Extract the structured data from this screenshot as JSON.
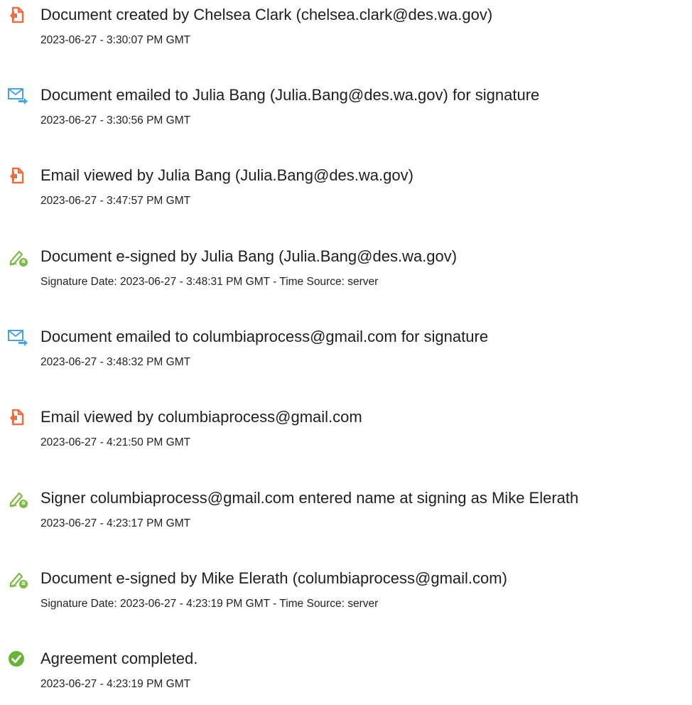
{
  "events": [
    {
      "icon": "document-created-icon",
      "title": "Document created by Chelsea Clark (chelsea.clark@des.wa.gov)",
      "stamp": "2023-06-27 - 3:30:07 PM GMT"
    },
    {
      "icon": "email-sent-icon",
      "title": "Document emailed to Julia Bang (Julia.Bang@des.wa.gov) for signature",
      "stamp": "2023-06-27 - 3:30:56 PM GMT"
    },
    {
      "icon": "document-created-icon",
      "title": "Email viewed by Julia Bang (Julia.Bang@des.wa.gov)",
      "stamp": "2023-06-27 - 3:47:57 PM GMT"
    },
    {
      "icon": "e-sign-pen-icon",
      "title": "Document e-signed by Julia Bang (Julia.Bang@des.wa.gov)",
      "stamp": "Signature Date: 2023-06-27 - 3:48:31 PM GMT - Time Source: server"
    },
    {
      "icon": "email-sent-icon",
      "title": "Document emailed to columbiaprocess@gmail.com for signature",
      "stamp": "2023-06-27 - 3:48:32 PM GMT"
    },
    {
      "icon": "document-created-icon",
      "title": "Email viewed by columbiaprocess@gmail.com",
      "stamp": "2023-06-27 - 4:21:50 PM GMT"
    },
    {
      "icon": "e-sign-pen-icon",
      "title": "Signer columbiaprocess@gmail.com entered name at signing as Mike Elerath",
      "stamp": "2023-06-27 - 4:23:17 PM GMT"
    },
    {
      "icon": "e-sign-pen-icon",
      "title": "Document e-signed by Mike Elerath (columbiaprocess@gmail.com)",
      "stamp": "Signature Date: 2023-06-27 - 4:23:19 PM GMT - Time Source: server"
    },
    {
      "icon": "check-circle-icon",
      "title": "Agreement completed.",
      "stamp": "2023-06-27 - 4:23:19 PM GMT"
    }
  ],
  "colors": {
    "document_icon": "#f26b3a",
    "email_icon": "#4aa3df",
    "pen_icon": "#7dbb45",
    "check_icon": "#68b338"
  }
}
